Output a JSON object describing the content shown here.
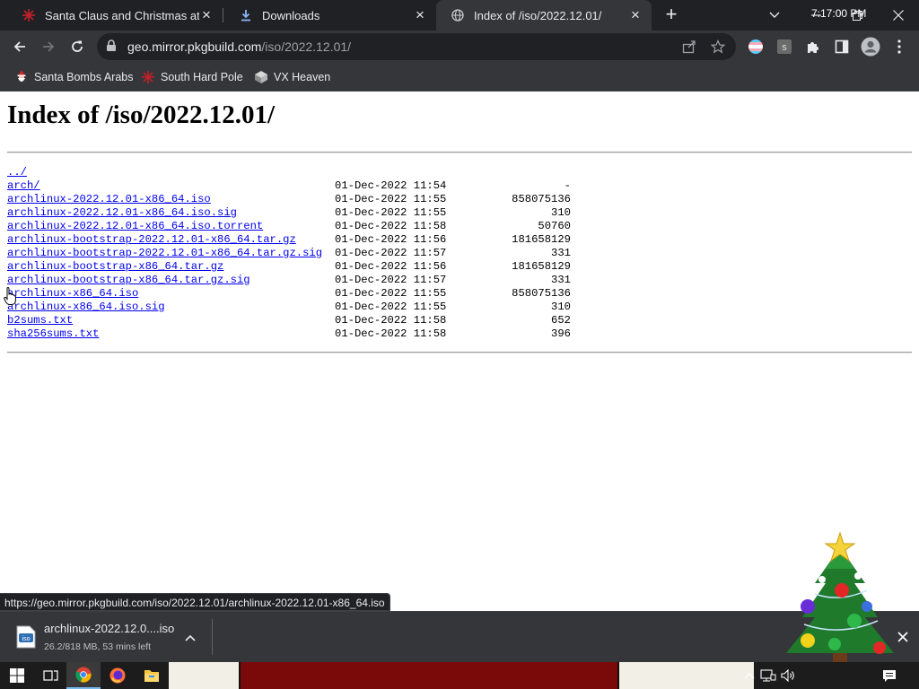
{
  "browser": {
    "tabs": [
      {
        "title": "Santa Claus and Christmas at the",
        "active": false,
        "icon": "red-snowflake-icon"
      },
      {
        "title": "Downloads",
        "active": false,
        "icon": "download-icon"
      },
      {
        "title": "Index of /iso/2022.12.01/",
        "active": true,
        "icon": "globe-icon"
      }
    ],
    "url_host": "geo.mirror.pkgbuild.com",
    "url_path": "/iso/2022.12.01/",
    "bookmarks": [
      {
        "label": "Santa Bombs Arabs",
        "icon": "santa-icon"
      },
      {
        "label": "South Hard Pole",
        "icon": "red-snowflake-icon"
      },
      {
        "label": "VX Heaven",
        "icon": "vx-heaven-icon"
      }
    ]
  },
  "page": {
    "heading": "Index of /iso/2022.12.01/",
    "entries": [
      {
        "name": "../",
        "date": "",
        "size": ""
      },
      {
        "name": "arch/",
        "date": "01-Dec-2022 11:54",
        "size": "-"
      },
      {
        "name": "archlinux-2022.12.01-x86_64.iso",
        "date": "01-Dec-2022 11:55",
        "size": "858075136"
      },
      {
        "name": "archlinux-2022.12.01-x86_64.iso.sig",
        "date": "01-Dec-2022 11:55",
        "size": "310"
      },
      {
        "name": "archlinux-2022.12.01-x86_64.iso.torrent",
        "date": "01-Dec-2022 11:58",
        "size": "50760"
      },
      {
        "name": "archlinux-bootstrap-2022.12.01-x86_64.tar.gz",
        "date": "01-Dec-2022 11:56",
        "size": "181658129"
      },
      {
        "name": "archlinux-bootstrap-2022.12.01-x86_64.tar.gz.sig",
        "date": "01-Dec-2022 11:57",
        "size": "331"
      },
      {
        "name": "archlinux-bootstrap-x86_64.tar.gz",
        "date": "01-Dec-2022 11:56",
        "size": "181658129"
      },
      {
        "name": "archlinux-bootstrap-x86_64.tar.gz.sig",
        "date": "01-Dec-2022 11:57",
        "size": "331"
      },
      {
        "name": "archlinux-x86_64.iso",
        "date": "01-Dec-2022 11:55",
        "size": "858075136"
      },
      {
        "name": "archlinux-x86_64.iso.sig",
        "date": "01-Dec-2022 11:55",
        "size": "310"
      },
      {
        "name": "b2sums.txt",
        "date": "01-Dec-2022 11:58",
        "size": "652"
      },
      {
        "name": "sha256sums.txt",
        "date": "01-Dec-2022 11:58",
        "size": "396"
      }
    ]
  },
  "status_url": "https://geo.mirror.pkgbuild.com/iso/2022.12.01/archlinux-2022.12.01-x86_64.iso",
  "download": {
    "filename": "archlinux-2022.12.0....iso",
    "status": "26.2/818 MB, 53 mins left",
    "icon": "iso-file-icon"
  },
  "taskbar": {
    "clock": "7:17:00 PM",
    "apps": [
      "windows-start-icon",
      "task-view-icon",
      "chrome-icon",
      "firefox-icon",
      "file-explorer-icon"
    ]
  },
  "colors": {
    "tab_bg": "#202124",
    "toolbar_bg": "#35363a",
    "link": "#0000ee",
    "taskbar": "#1c1c1c"
  }
}
